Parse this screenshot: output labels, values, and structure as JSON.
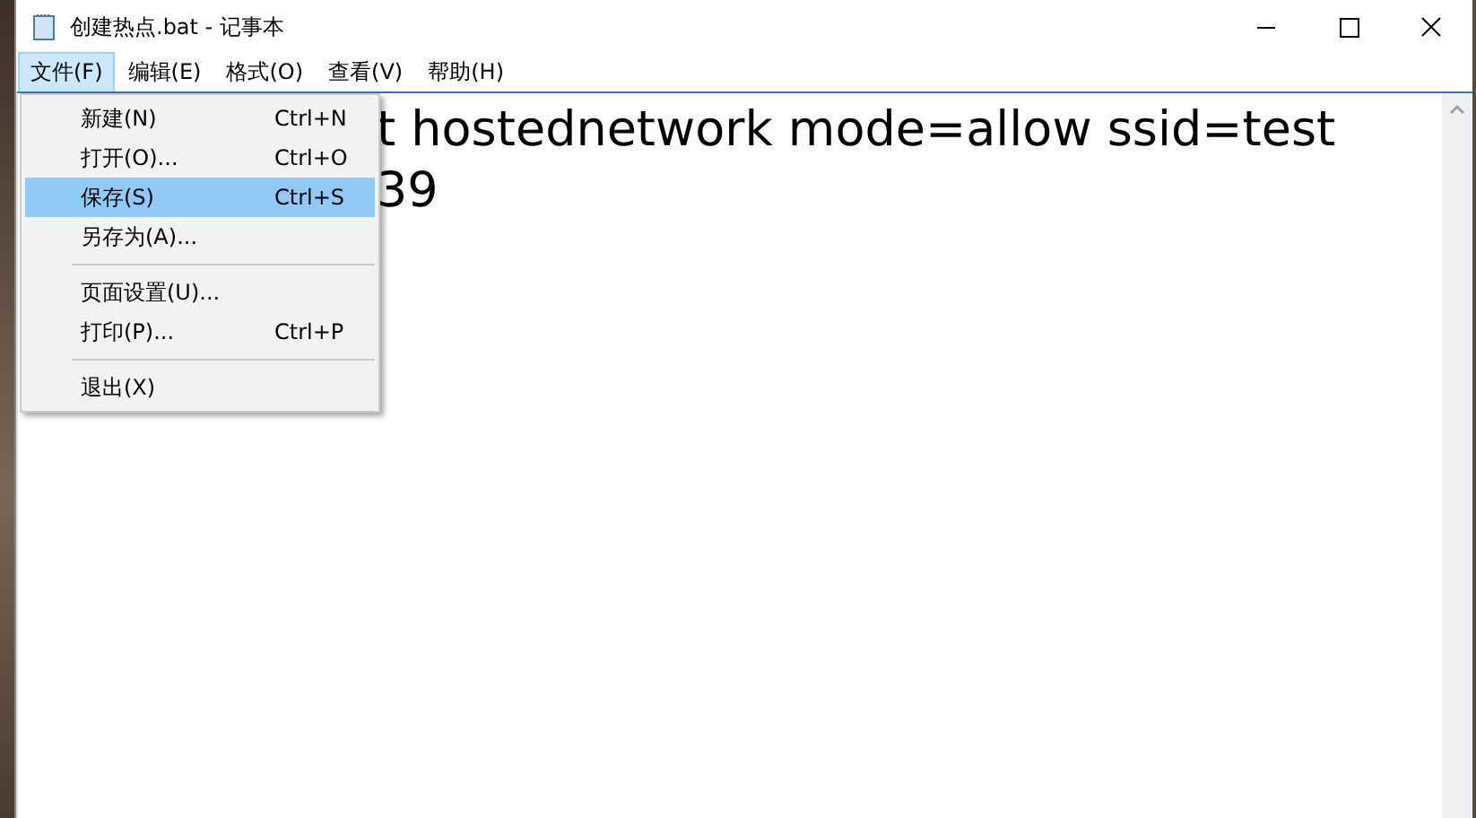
{
  "window": {
    "title": "创建热点.bat - 记事本"
  },
  "menu_bar": [
    {
      "label": "文件(F)",
      "selected": true
    },
    {
      "label": "编辑(E)",
      "selected": false
    },
    {
      "label": "格式(O)",
      "selected": false
    },
    {
      "label": "查看(V)",
      "selected": false
    },
    {
      "label": "帮助(H)",
      "selected": false
    }
  ],
  "file_menu": [
    {
      "kind": "item",
      "label": "新建(N)",
      "shortcut": "Ctrl+N",
      "selected": false
    },
    {
      "kind": "item",
      "label": "打开(O)...",
      "shortcut": "Ctrl+O",
      "selected": false
    },
    {
      "kind": "item",
      "label": "保存(S)",
      "shortcut": "Ctrl+S",
      "selected": true
    },
    {
      "kind": "item",
      "label": "另存为(A)...",
      "selected": false
    },
    {
      "kind": "separator"
    },
    {
      "kind": "item",
      "label": "页面设置(U)...",
      "selected": false
    },
    {
      "kind": "item",
      "label": "打印(P)...",
      "shortcut": "Ctrl+P",
      "selected": false
    },
    {
      "kind": "separator"
    },
    {
      "kind": "item",
      "label": "退出(X)",
      "selected": false
    }
  ],
  "editor": {
    "lines": [
      "t hostednetwork mode=allow ssid=test",
      "39"
    ]
  }
}
